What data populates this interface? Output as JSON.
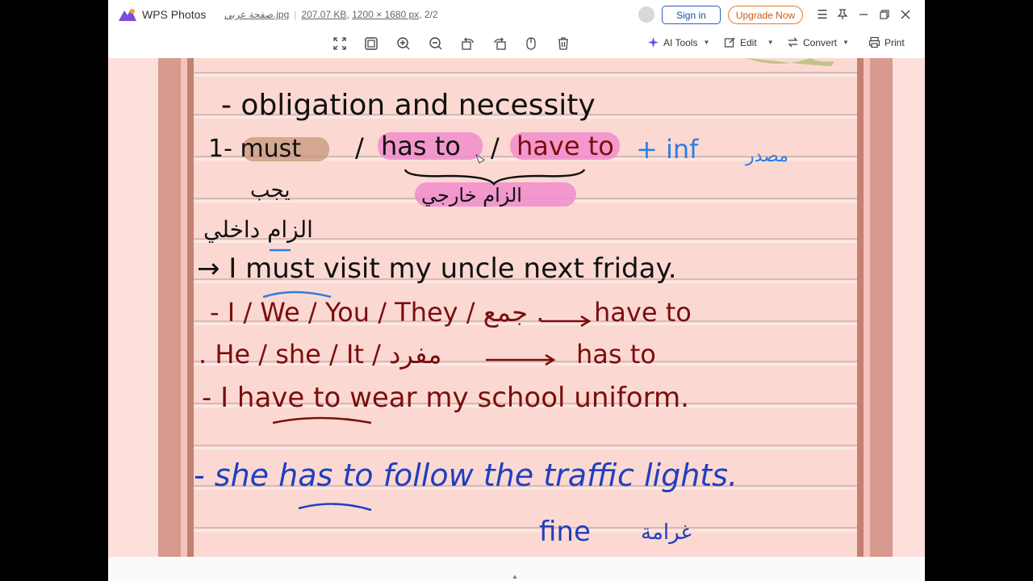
{
  "app": {
    "name": "WPS Photos",
    "file_name": "صفحة عربي.jpg",
    "file_size": "207.07 KB",
    "dimensions": "1200 × 1680 px",
    "page_index": "2/2"
  },
  "header": {
    "sign_in": "Sign in",
    "upgrade": "Upgrade Now"
  },
  "toolbar": {
    "ai_tools": "AI Tools",
    "edit": "Edit",
    "convert": "Convert",
    "print": "Print"
  },
  "icons": {
    "fit": "fit-screen-icon",
    "original": "actual-size-icon",
    "zoom_in": "zoom-in-icon",
    "zoom_out": "zoom-out-icon",
    "rotate_left": "rotate-left-icon",
    "rotate_right": "rotate-right-icon",
    "mirror": "flip-icon",
    "delete": "trash-icon"
  },
  "colors": {
    "page_bg": "#fde0dc",
    "brand_blue": "#2a5dc4",
    "upgrade_orange": "#e67a2a",
    "ink_black": "#111111",
    "ink_red": "#7a0e0e",
    "ink_blue": "#1f3fbf",
    "highlight_pink": "#f08ccc"
  },
  "note": {
    "line1": "- obligation and necessity",
    "line2_must": "1- must",
    "line2_slash1": "/",
    "line2_has_to": "has to",
    "line2_slash2": "/",
    "line2_have_to": "have to",
    "line2_inf": "+ inf",
    "line2_arabic_inf": "مصدر",
    "line3_arabic_must": "يجب",
    "line3_arabic_external": "الزام خارجي",
    "line4_arabic_internal": "الزام داخلي",
    "line5": "→ I must visit my uncle next friday.",
    "line6_left": "- I / We / You / They / جمع .",
    "line6_right": "have to",
    "line7_left": ". He / she / It / مفرد",
    "line7_right": "has to",
    "line8": "- I have to wear my school uniform.",
    "line9": "- she has to follow the traffic lights.",
    "line10_en": "fine",
    "line10_ar": "غرامة"
  }
}
